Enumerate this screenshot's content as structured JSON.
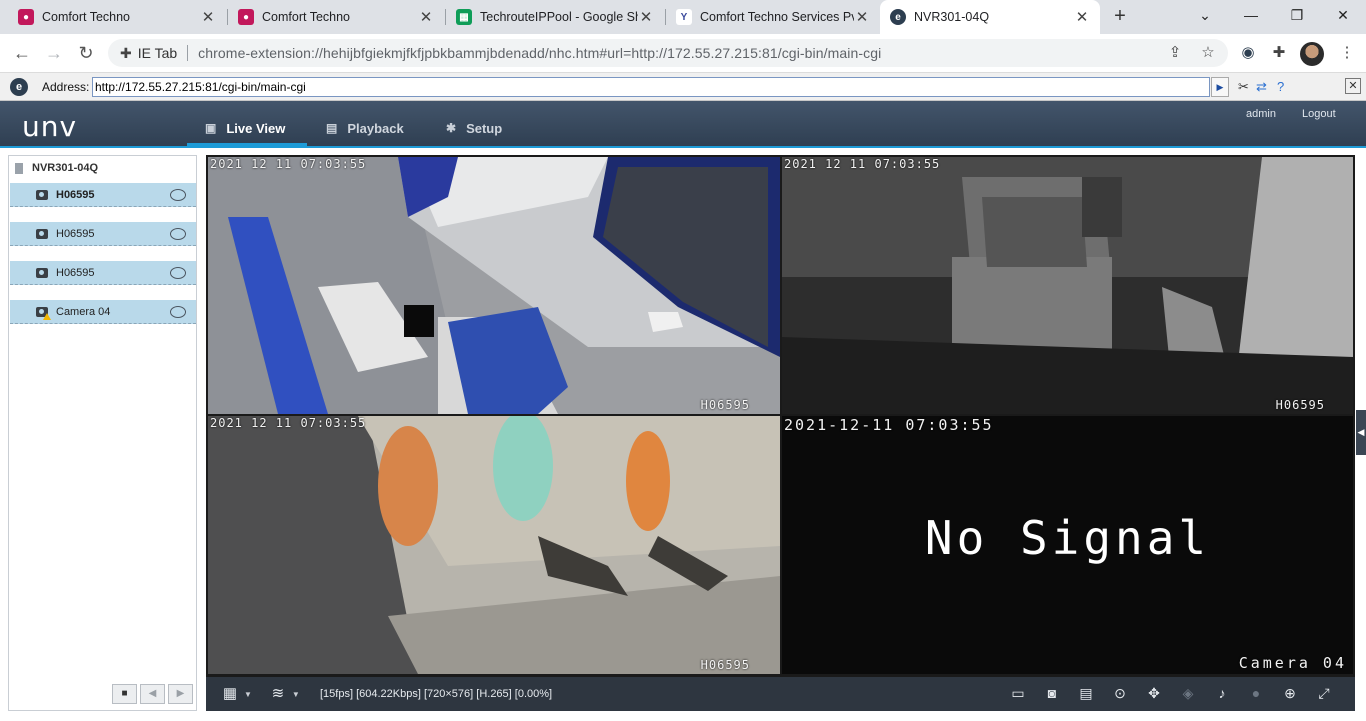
{
  "browser": {
    "tabs": [
      {
        "title": "Comfort Techno",
        "favicon": "#c2185b",
        "active": false
      },
      {
        "title": "Comfort Techno",
        "favicon": "#c2185b",
        "active": false
      },
      {
        "title": "TechrouteIPPool - Google Sh",
        "favicon": "#0f9d58",
        "active": false
      },
      {
        "title": "Comfort Techno Services Pvt",
        "favicon": "#3b4a9c",
        "active": false
      },
      {
        "title": "NVR301-04Q",
        "favicon": "#2d3e50",
        "active": true
      }
    ],
    "omnibox_prefix": "IE Tab",
    "url": "chrome-extension://hehijbfgiekmjfkfjpbkbammjbdenadd/nhc.htm#url=http://172.55.27.215:81/cgi-bin/main-cgi"
  },
  "ietab": {
    "address_label": "Address:",
    "address_value": "http://172.55.27.215:81/cgi-bin/main-cgi"
  },
  "nvr": {
    "logo": "unv",
    "nav": [
      {
        "label": "Live View",
        "active": true
      },
      {
        "label": "Playback",
        "active": false
      },
      {
        "label": "Setup",
        "active": false
      }
    ],
    "user": "admin",
    "logout": "Logout",
    "device_name": "NVR301-04Q",
    "cameras": [
      {
        "name": "H06595",
        "bold": true,
        "warning": false
      },
      {
        "name": "H06595",
        "bold": false,
        "warning": false
      },
      {
        "name": "H06595",
        "bold": false,
        "warning": false
      },
      {
        "name": "Camera 04",
        "bold": false,
        "warning": true
      }
    ],
    "views": [
      {
        "timestamp": "2021 12 11  07:03:55",
        "name": "H06595"
      },
      {
        "timestamp": "2021 12 11  07:03:55",
        "name": "H06595"
      },
      {
        "timestamp": "2021 12 11  07:03:55",
        "name": "H06595"
      },
      {
        "timestamp": "2021-12-11  07:03:55",
        "name": "Camera 04",
        "message": "No Signal"
      }
    ],
    "stream_info": "[15fps] [604.22Kbps] [720×576] [H.265] [0.00%]"
  }
}
